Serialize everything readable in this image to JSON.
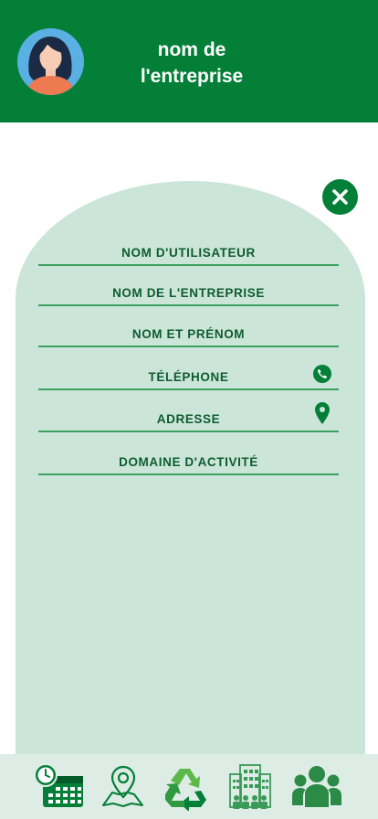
{
  "header": {
    "title_line1": "nom de",
    "title_line2": "l'entreprise",
    "avatar_icon": "user-avatar-icon",
    "background_color": "#047f38"
  },
  "form": {
    "close_icon": "close-icon",
    "fields": [
      {
        "label": "NOM D'UTILISATEUR",
        "icon": null
      },
      {
        "label": "NOM DE L'ENTREPRISE",
        "icon": null
      },
      {
        "label": "NOM ET PRÉNOM",
        "icon": null
      },
      {
        "label": "TÉLÉPHONE",
        "icon": "phone-icon"
      },
      {
        "label": "ADRESSE",
        "icon": "location-pin-icon"
      },
      {
        "label": "DOMAINE D'ACTIVITÉ",
        "icon": null
      }
    ],
    "card_color": "#cce5d9",
    "accent_color": "#3aa05e"
  },
  "bottom_nav": {
    "items": [
      {
        "icon": "calendar-clock-icon"
      },
      {
        "icon": "map-location-icon"
      },
      {
        "icon": "recycle-icon"
      },
      {
        "icon": "building-icon"
      },
      {
        "icon": "team-icon"
      }
    ],
    "background_color": "#ddece4"
  }
}
